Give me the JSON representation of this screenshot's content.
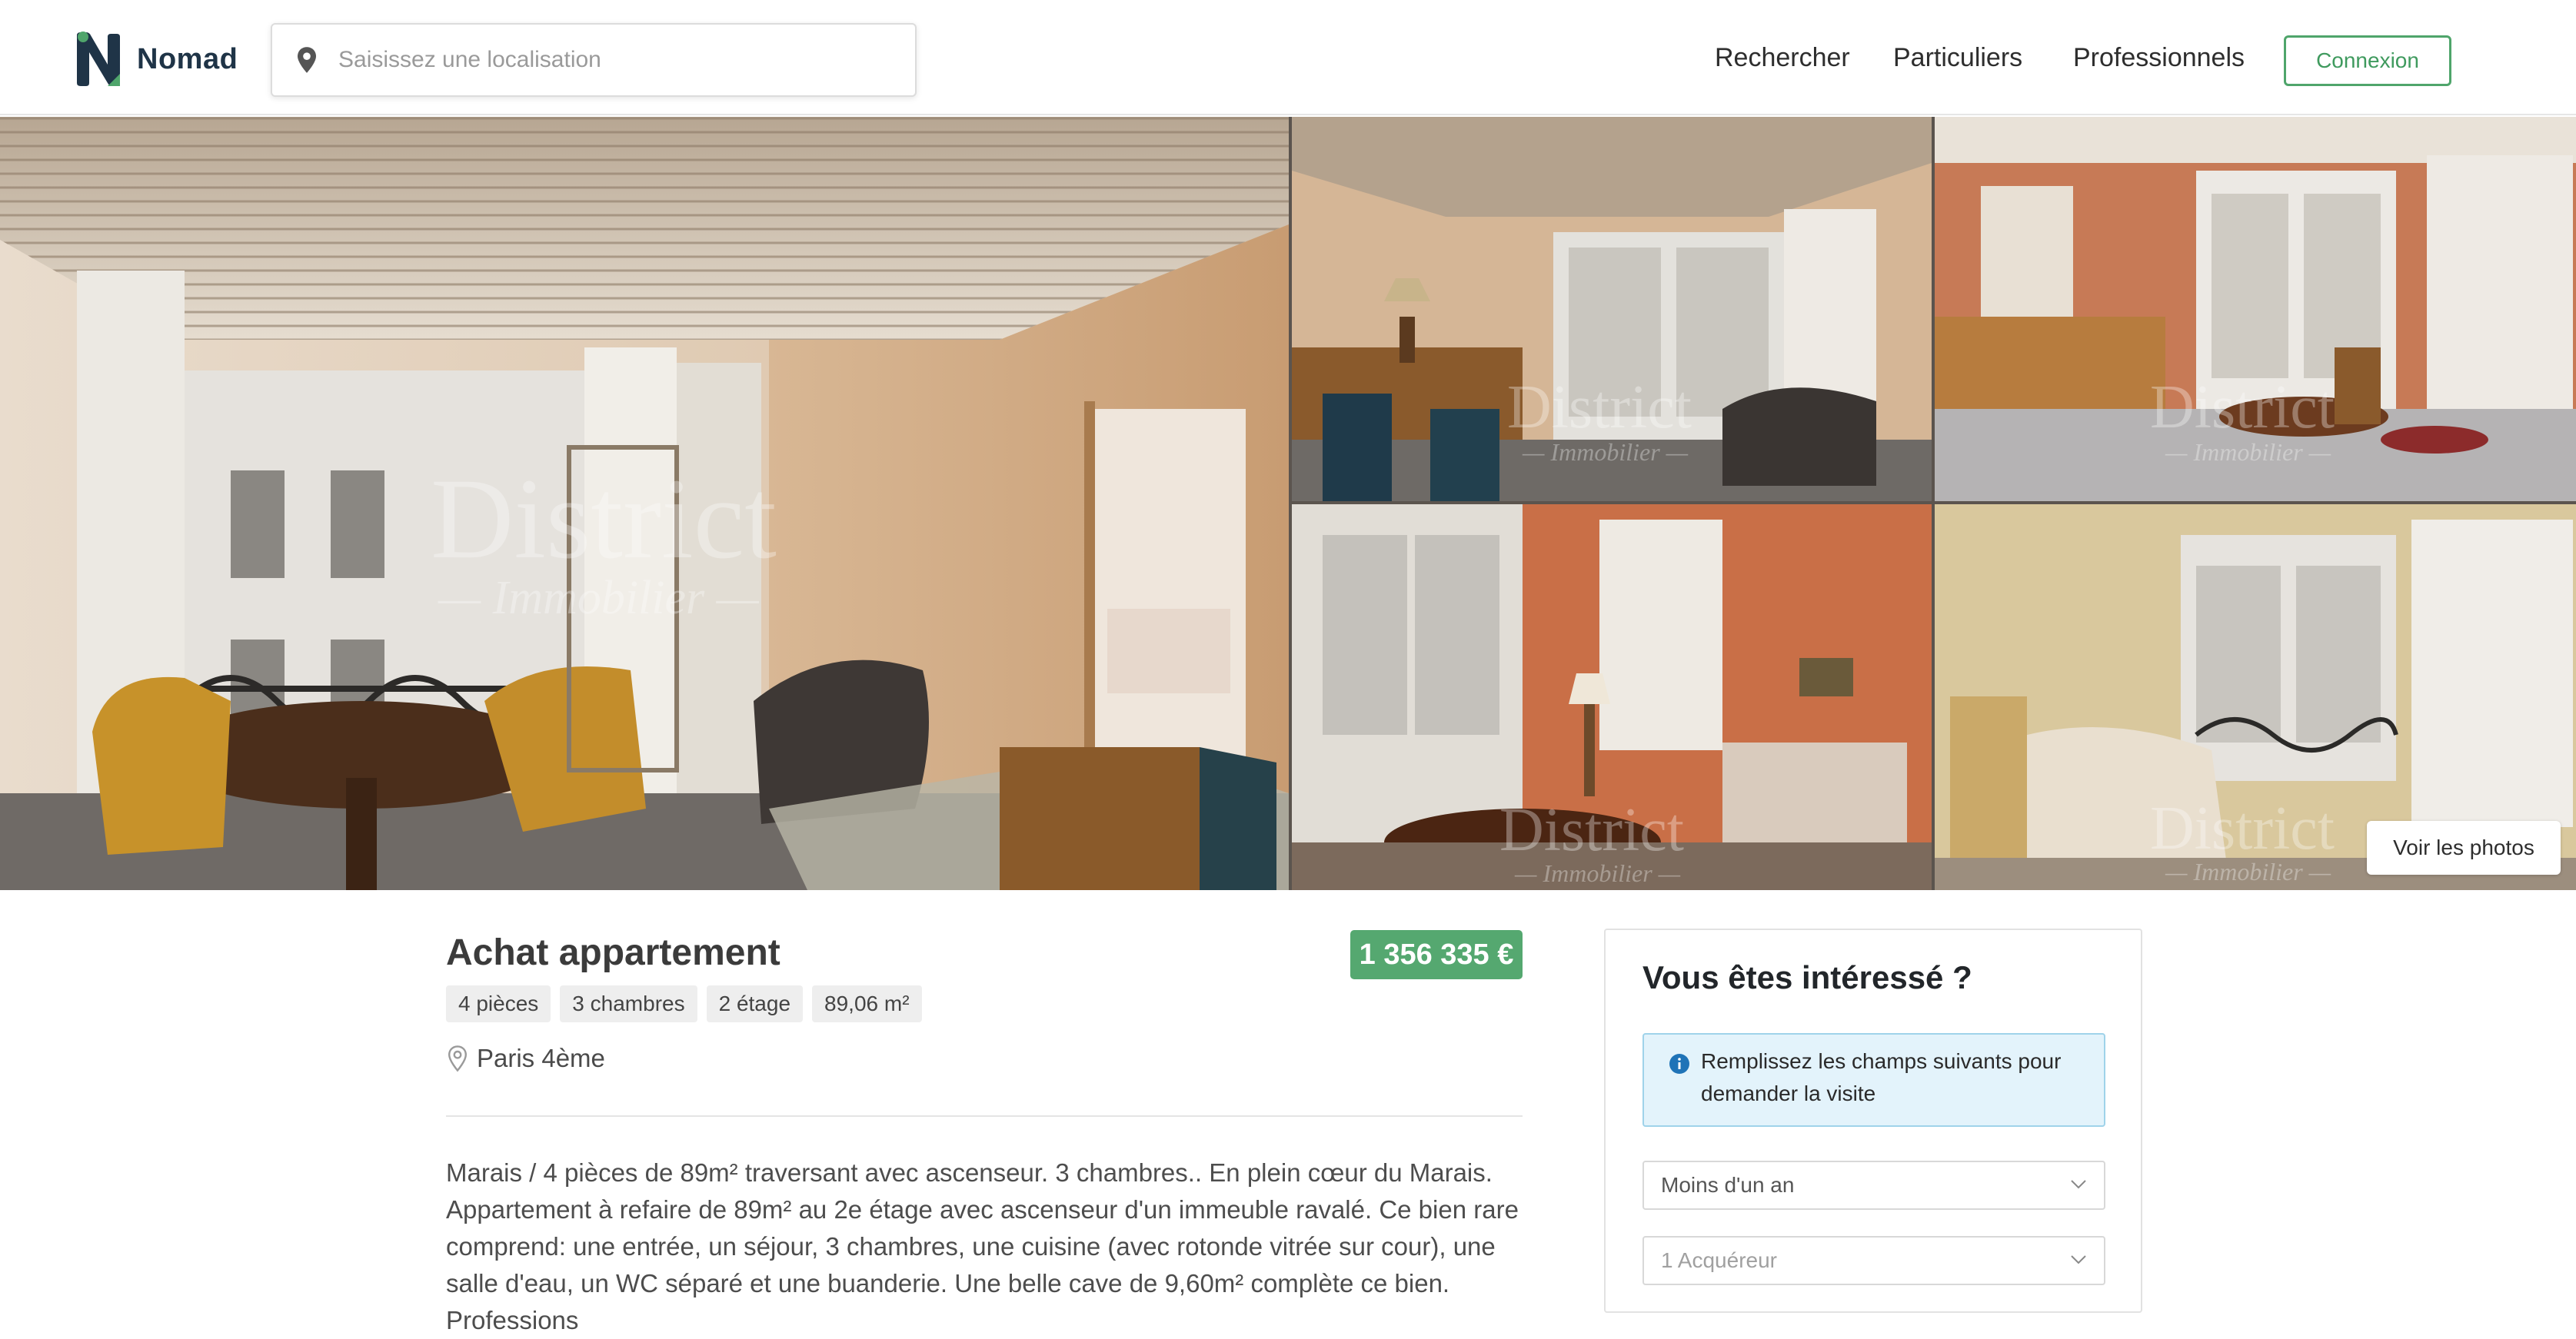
{
  "header": {
    "brand": "Nomad",
    "search_placeholder": "Saisissez une localisation",
    "nav": [
      "Rechercher",
      "Particuliers",
      "Professionnels"
    ],
    "login_label": "Connexion"
  },
  "gallery": {
    "watermark_main": "District",
    "watermark_sub": "— Immobilier —",
    "view_photos_label": "Voir les photos"
  },
  "listing": {
    "title": "Achat appartement",
    "price": "1 356 335 €",
    "tags": [
      "4 pièces",
      "3 chambres",
      "2 étage",
      "89,06 m²"
    ],
    "location": "Paris 4ème",
    "description": "Marais / 4 pièces de 89m² traversant avec ascenseur. 3 chambres.. En plein cœur du Marais. Appartement à refaire de 89m² au 2e étage avec ascenseur d'un immeuble ravalé. Ce bien rare comprend: une entrée, un séjour, 3 chambres, une cuisine (avec rotonde vitrée sur cour), une salle d'eau, un WC séparé et une buanderie. Une belle cave de 9,60m² complète ce bien. Professions"
  },
  "contact": {
    "title": "Vous êtes intéressé ?",
    "info": "Remplissez les champs suivants pour demander la visite",
    "timeframe": "Moins d'un an",
    "buyers_placeholder": "1 Acquéreur"
  },
  "colors": {
    "brand_navy": "#1f3447",
    "brand_green": "#4fa56b",
    "price_green": "#55a870",
    "info_bg": "#e3f3fb"
  }
}
